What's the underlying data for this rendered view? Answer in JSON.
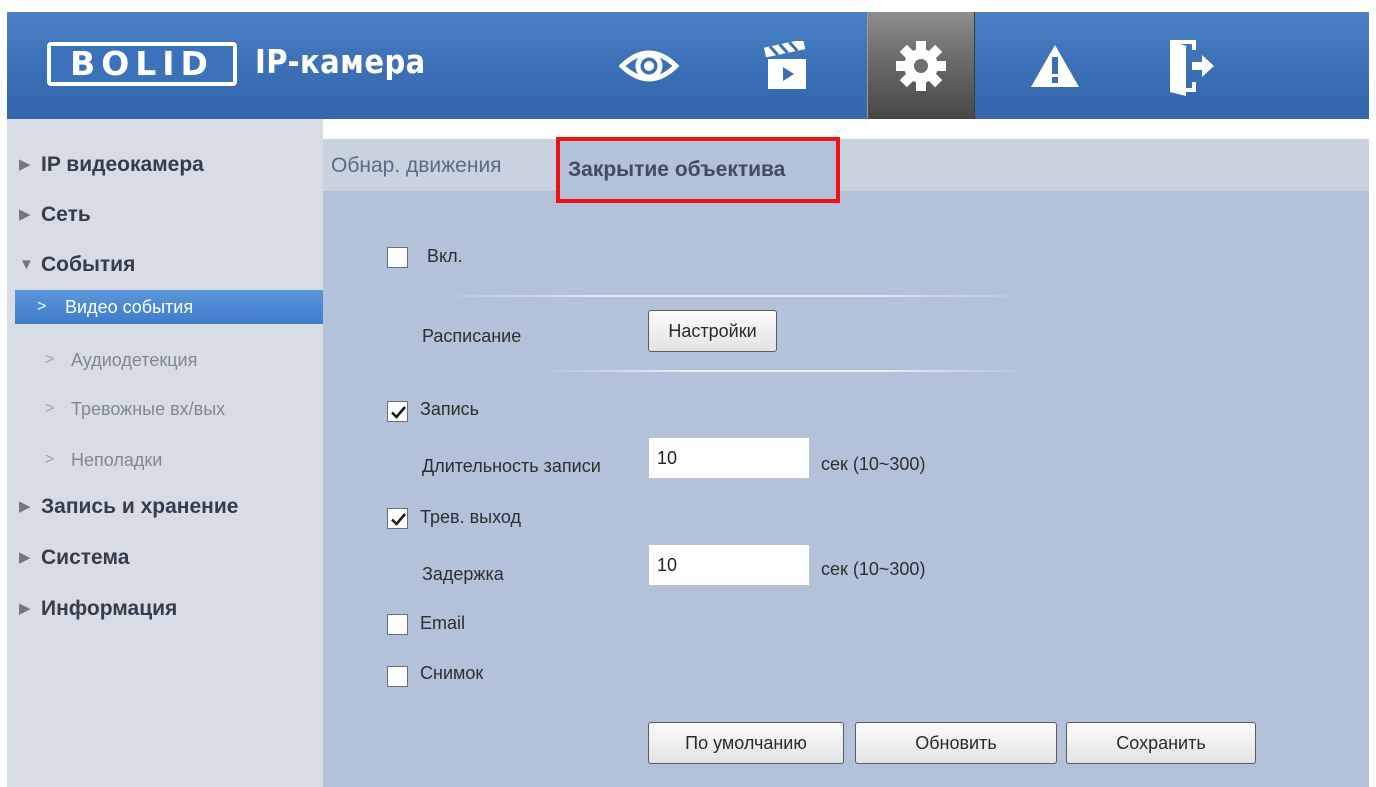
{
  "header": {
    "logo": "BOLID",
    "title": "IP-камера",
    "nav": [
      {
        "name": "live-view",
        "icon": "eye-icon"
      },
      {
        "name": "playback",
        "icon": "clapperboard-icon"
      },
      {
        "name": "settings",
        "icon": "gear-icon",
        "active": true
      },
      {
        "name": "alarm",
        "icon": "warning-icon"
      },
      {
        "name": "logout",
        "icon": "exit-door-icon"
      }
    ],
    "colors": {
      "bar": "#3a6fb6",
      "active": "#6a6a6a"
    }
  },
  "sidebar": {
    "items": [
      {
        "label": "IP видеокамера",
        "expanded": false
      },
      {
        "label": "Сеть",
        "expanded": false
      },
      {
        "label": "События",
        "expanded": true
      },
      {
        "label": "Запись и хранение",
        "expanded": false
      },
      {
        "label": "Система",
        "expanded": false
      },
      {
        "label": "Информация",
        "expanded": false
      }
    ],
    "subitems": [
      {
        "label": "Видео события",
        "active": true
      },
      {
        "label": "Аудиодетекция"
      },
      {
        "label": "Тревожные вх/вых"
      },
      {
        "label": "Неполадки"
      }
    ]
  },
  "tabs": [
    {
      "label": "Обнар. движения",
      "active": false
    },
    {
      "label": "Закрытие объектива",
      "active": true,
      "highlight": "#ee1212"
    }
  ],
  "form": {
    "enable": {
      "label": "Вкл.",
      "checked": false
    },
    "schedule": {
      "label": "Расписание",
      "button": "Настройки"
    },
    "record": {
      "label": "Запись",
      "checked": true
    },
    "record_duration": {
      "label": "Длительность записи",
      "value": "10",
      "unit": "сек (10~300)"
    },
    "alarm_out": {
      "label": "Трев. выход",
      "checked": true
    },
    "delay": {
      "label": "Задержка",
      "value": "10",
      "unit": "сек (10~300)"
    },
    "email": {
      "label": "Email",
      "checked": false
    },
    "snapshot": {
      "label": "Снимок",
      "checked": false
    }
  },
  "buttons": {
    "default": "По умолчанию",
    "refresh": "Обновить",
    "save": "Сохранить"
  }
}
